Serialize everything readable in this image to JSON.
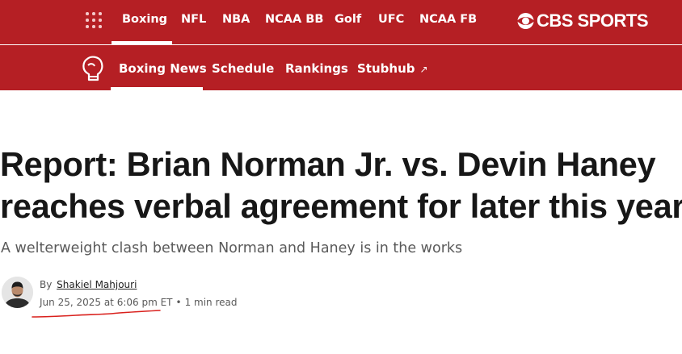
{
  "top_nav": {
    "sports": [
      "Boxing",
      "NFL",
      "NBA",
      "NCAA BB",
      "Golf",
      "UFC",
      "NCAA FB"
    ],
    "active": "Boxing",
    "logo_text": "CBS SPORTS",
    "menu_icon": "grid-menu-icon",
    "background": "#b51f24"
  },
  "sub_nav": {
    "icon": "boxing-glove-icon",
    "items": [
      "Boxing News",
      "Schedule",
      "Rankings",
      "Stubhub"
    ],
    "active": "Boxing News",
    "external_arrow": "↗"
  },
  "article": {
    "headline_lines": [
      "Report: Brian Norman Jr. vs. Devin Haney",
      "reaches verbal agreement for later this year"
    ],
    "dek": "A welterweight clash between Norman and Haney is in the works",
    "byline_prefix": "By",
    "author": "Shakiel Mahjouri",
    "date": "Jun 25, 2025 at 6:06 pm ET",
    "separator": "•",
    "read_time": "1 min read",
    "annotation_color": "#d9201c"
  }
}
